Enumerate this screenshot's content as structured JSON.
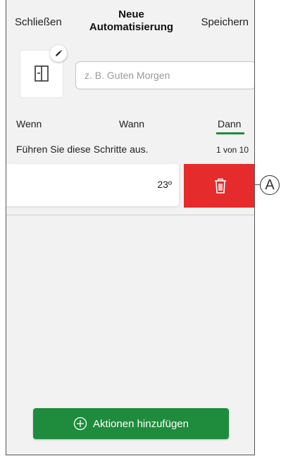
{
  "header": {
    "close_label": "Schließen",
    "title_line1": "Neue",
    "title_line2": "Automatisierung",
    "save_label": "Speichern"
  },
  "name": {
    "placeholder": "z. B. Guten Morgen"
  },
  "icons": {
    "automation": "window-panel-icon",
    "edit": "pencil-icon",
    "delete": "trash-icon",
    "add": "plus-circle-icon"
  },
  "tabs": [
    {
      "label": "Wenn"
    },
    {
      "label": "Wann"
    },
    {
      "label": "Dann",
      "active": true
    }
  ],
  "steps": {
    "label": "Führen Sie diese Schritte aus.",
    "count": "1 von 10"
  },
  "actions": [
    {
      "value": "23º"
    }
  ],
  "add_button_label": "Aktionen hinzufügen",
  "callout_label": "A",
  "colors": {
    "accent_green": "#1e8c3c",
    "delete_red": "#e52b2b",
    "background": "#f2f2f2"
  }
}
